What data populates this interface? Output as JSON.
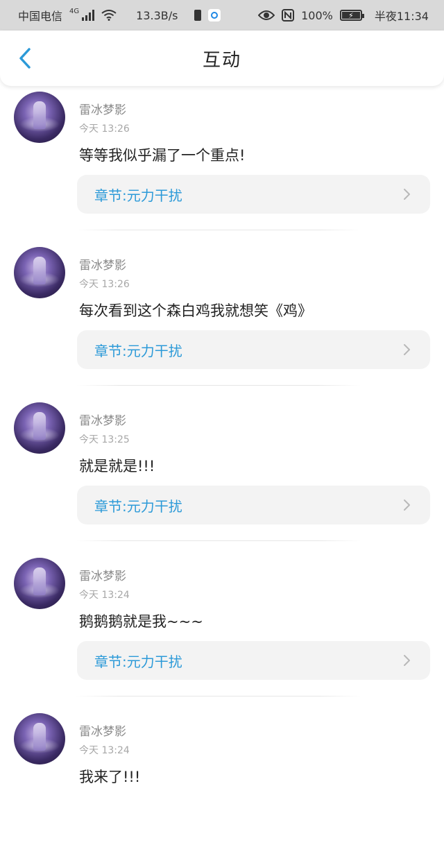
{
  "status_bar": {
    "carrier": "中国电信",
    "network": "4G",
    "speed": "13.3B/s",
    "battery_percent": "100%",
    "time": "半夜11:34"
  },
  "header": {
    "title": "互动"
  },
  "feed": [
    {
      "name": "雷冰梦影",
      "time": "今天 13:26",
      "content": "等等我似乎漏了一个重点!",
      "chapter": "章节:元力干扰"
    },
    {
      "name": "雷冰梦影",
      "time": "今天 13:26",
      "content": "每次看到这个森白鸡我就想笑《鸡》",
      "chapter": "章节:元力干扰"
    },
    {
      "name": "雷冰梦影",
      "time": "今天 13:25",
      "content": "就是就是!!!",
      "chapter": "章节:元力干扰"
    },
    {
      "name": "雷冰梦影",
      "time": "今天 13:24",
      "content": "鹅鹅鹅就是我~~~",
      "chapter": "章节:元力干扰"
    },
    {
      "name": "雷冰梦影",
      "time": "今天 13:24",
      "content": "我来了!!!",
      "chapter": ""
    }
  ],
  "colors": {
    "accent": "#2c9ad8",
    "card_bg": "#f3f3f3",
    "status_bar_bg": "#d9d9d9"
  },
  "icons": {
    "back": "chevron-left-icon",
    "card_arrow": "chevron-right-icon"
  }
}
